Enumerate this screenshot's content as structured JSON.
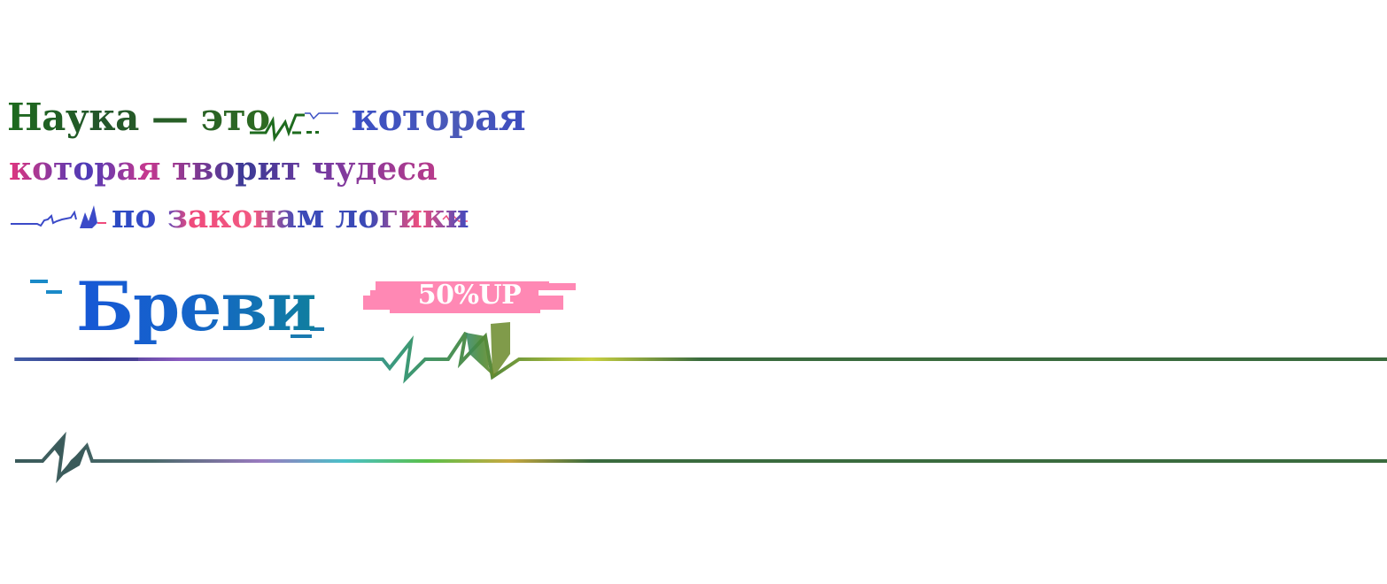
{
  "tagline": {
    "line1_part1": "Наука — это",
    "line1_part2": "которая",
    "line2": "которая творит чудеса",
    "line3": "по законам логики"
  },
  "logo": {
    "word": "Бреви"
  },
  "badge": {
    "label": "50%UP",
    "color": "#ff88b4"
  },
  "colors": {
    "green": "#3a6b3e",
    "blue": "#1565c8",
    "pink": "#ef4a7c",
    "indigo": "#3b4ac2"
  }
}
